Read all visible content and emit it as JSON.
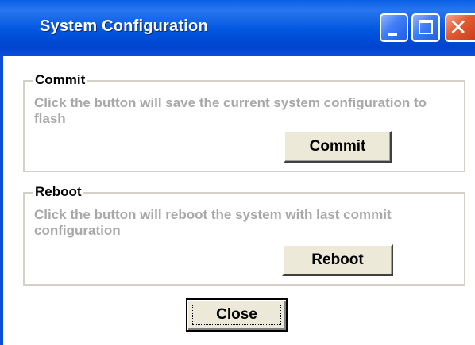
{
  "window": {
    "title": "System Configuration",
    "controls": {
      "minimize_icon": "minimize-icon",
      "maximize_icon": "maximize-icon",
      "close_icon": "close-icon",
      "close_glyph": "✕"
    }
  },
  "commit_group": {
    "legend": "Commit",
    "description": "Click the button will save the current system configuration to flash",
    "button_label": "Commit"
  },
  "reboot_group": {
    "legend": "Reboot",
    "description": "Click the button will reboot the system with last commit configuration",
    "button_label": "Reboot"
  },
  "footer": {
    "close_label": "Close"
  },
  "colors": {
    "titlebar": "#0056e0",
    "title_text": "#ffffff",
    "group_border": "#d4d0c8",
    "description_text": "#a8a8a8",
    "button_face": "#ece9d8",
    "close_control": "#e25a32"
  }
}
